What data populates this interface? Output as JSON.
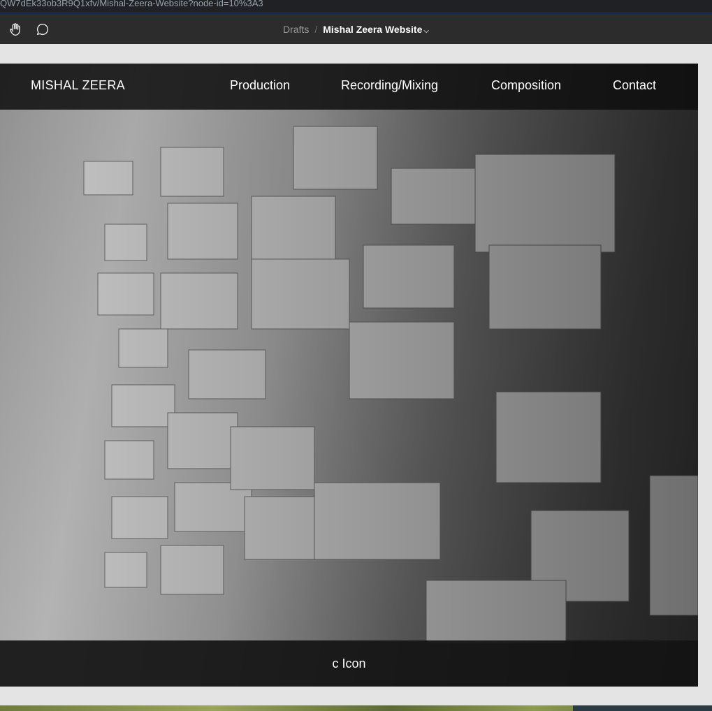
{
  "browser": {
    "url": "QW7dEk33ob3R9Q1xfv/Mishal-Zeera-Website?node-id=10%3A3"
  },
  "toolbar": {
    "hand_tool_icon": "hand-icon",
    "comment_tool_icon": "comment-icon",
    "breadcrumb_root": "Drafts",
    "breadcrumb_separator": "/",
    "file_name": "Mishal Zeera Website",
    "file_menu_icon": "chevron-down-icon"
  },
  "site": {
    "brand": "MISHAL ZEERA",
    "nav": [
      {
        "label": "Production"
      },
      {
        "label": "Recording/Mixing"
      },
      {
        "label": "Composition"
      },
      {
        "label": "Contact"
      }
    ],
    "hero_image": "grayscale acoustic diffuser blocks",
    "footer_text": "c Icon"
  },
  "colors": {
    "toolbar_bg": "#2c2c2c",
    "canvas_bg": "#e4e4e4",
    "nav_bg": "#0e0e0e",
    "text": "#ffffff"
  }
}
